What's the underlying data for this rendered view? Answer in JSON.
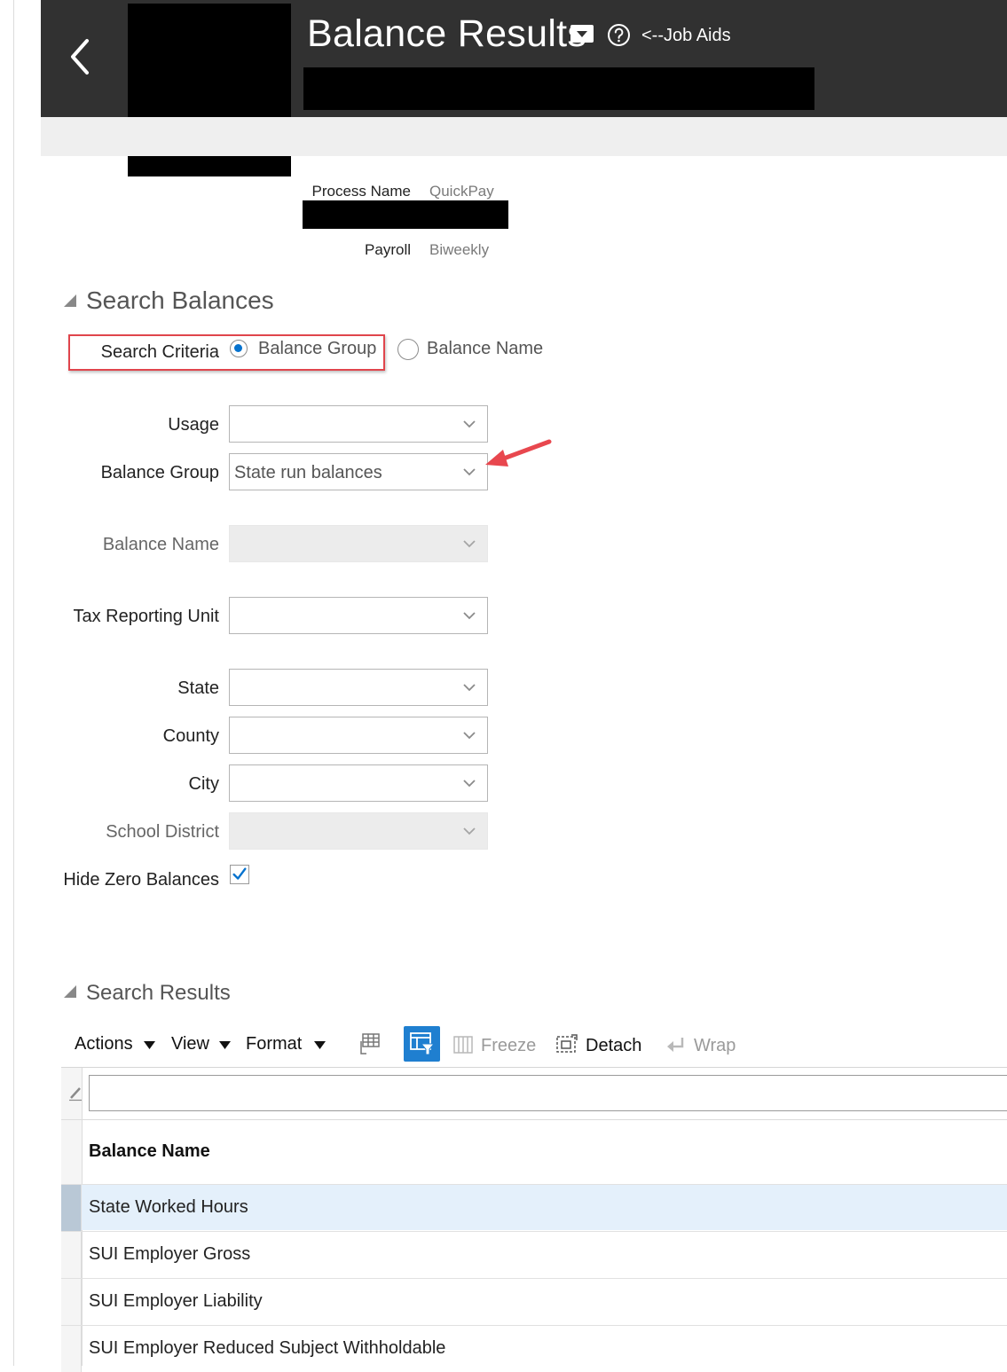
{
  "colors": {
    "header_bg": "#313131",
    "accent": "#0572ce",
    "highlight_border": "#e0454c",
    "selected_row": "#e4f0fb"
  },
  "header": {
    "title": "Balance Results",
    "job_aids_link": "<--Job Aids",
    "icons": [
      "back-chevron-icon",
      "message-icon",
      "help-icon"
    ]
  },
  "summary": {
    "process_name_label": "Process Name",
    "process_name_value": "QuickPay",
    "payroll_label": "Payroll",
    "payroll_value": "Biweekly"
  },
  "search_balances": {
    "title": "Search Balances",
    "search_criteria_label": "Search Criteria",
    "options": [
      {
        "label": "Balance Group",
        "selected": true
      },
      {
        "label": "Balance Name",
        "selected": false
      }
    ],
    "fields": {
      "usage": {
        "label": "Usage",
        "value": ""
      },
      "balance_group": {
        "label": "Balance Group",
        "value": "State run balances"
      },
      "balance_name": {
        "label": "Balance Name",
        "value": "",
        "disabled": true
      },
      "tax_reporting_unit": {
        "label": "Tax Reporting Unit",
        "value": ""
      },
      "state": {
        "label": "State",
        "value": ""
      },
      "county": {
        "label": "County",
        "value": ""
      },
      "city": {
        "label": "City",
        "value": ""
      },
      "school_district": {
        "label": "School District",
        "value": "",
        "disabled": true
      }
    },
    "hide_zero_balances": {
      "label": "Hide Zero Balances",
      "checked": true
    }
  },
  "search_results": {
    "title": "Search Results",
    "toolbar": {
      "actions": "Actions",
      "view": "View",
      "format": "Format",
      "freeze": "Freeze",
      "detach": "Detach",
      "wrap": "Wrap"
    },
    "filter_value": "",
    "column_header": "Balance Name",
    "rows": [
      "State Worked Hours",
      "SUI Employer Gross",
      "SUI Employer Liability",
      "SUI Employer Reduced Subject Withholdable"
    ]
  }
}
